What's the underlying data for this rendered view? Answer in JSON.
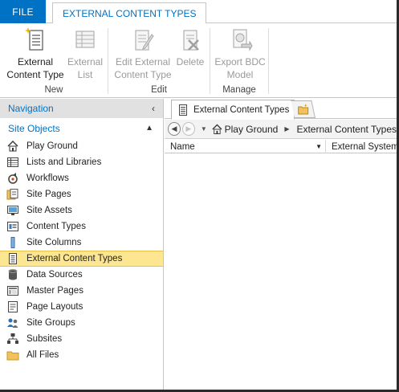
{
  "tabs": {
    "file": "FILE",
    "active": "EXTERNAL CONTENT TYPES"
  },
  "ribbon": {
    "groups": [
      {
        "label": "New",
        "buttons": [
          {
            "line1": "External",
            "line2": "Content Type",
            "enabled": true,
            "icon": "new-content-type-icon"
          },
          {
            "line1": "External",
            "line2": "List",
            "enabled": false,
            "icon": "external-list-icon"
          }
        ]
      },
      {
        "label": "Edit",
        "buttons": [
          {
            "line1": "Edit External",
            "line2": "Content Type",
            "enabled": false,
            "icon": "edit-content-type-icon"
          },
          {
            "line1": "Delete",
            "line2": "",
            "enabled": false,
            "icon": "delete-icon"
          }
        ]
      },
      {
        "label": "Manage",
        "buttons": [
          {
            "line1": "Export BDC",
            "line2": "Model",
            "enabled": false,
            "icon": "export-bdc-icon"
          }
        ]
      }
    ]
  },
  "nav": {
    "header": "Navigation",
    "section": "Site Objects",
    "items": [
      {
        "label": "Play Ground",
        "icon": "home-icon"
      },
      {
        "label": "Lists and Libraries",
        "icon": "lists-icon"
      },
      {
        "label": "Workflows",
        "icon": "workflow-icon"
      },
      {
        "label": "Site Pages",
        "icon": "site-pages-icon"
      },
      {
        "label": "Site Assets",
        "icon": "site-assets-icon"
      },
      {
        "label": "Content Types",
        "icon": "content-types-icon"
      },
      {
        "label": "Site Columns",
        "icon": "site-columns-icon"
      },
      {
        "label": "External Content Types",
        "icon": "external-content-types-icon",
        "selected": true
      },
      {
        "label": "Data Sources",
        "icon": "data-sources-icon"
      },
      {
        "label": "Master Pages",
        "icon": "master-pages-icon"
      },
      {
        "label": "Page Layouts",
        "icon": "page-layouts-icon"
      },
      {
        "label": "Site Groups",
        "icon": "site-groups-icon"
      },
      {
        "label": "Subsites",
        "icon": "subsites-icon"
      },
      {
        "label": "All Files",
        "icon": "folder-icon"
      }
    ]
  },
  "content": {
    "doc_tab": "External Content Types",
    "breadcrumb": [
      "Play Ground",
      "External Content Types"
    ],
    "columns": [
      "Name",
      "External System"
    ]
  },
  "colors": {
    "accent": "#0072c6",
    "selected_bg": "#fce691"
  }
}
